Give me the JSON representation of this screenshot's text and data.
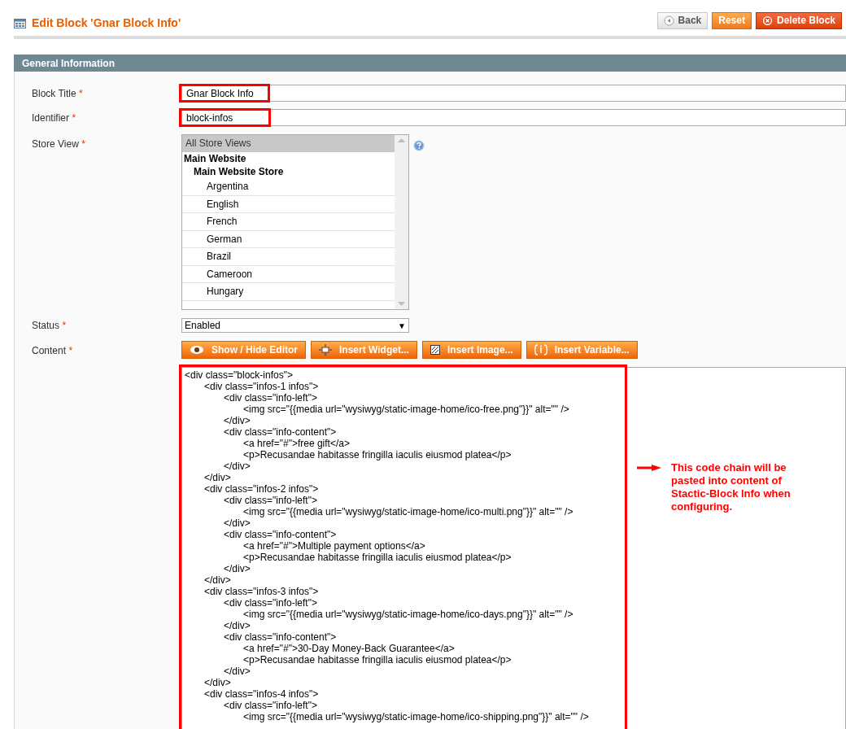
{
  "page": {
    "title": "Edit Block 'Gnar Block Info'",
    "buttons": [
      {
        "kind": "back",
        "label": "Back"
      },
      {
        "kind": "reset",
        "label": "Reset"
      },
      {
        "kind": "delete",
        "label": "Delete Block"
      }
    ]
  },
  "section": {
    "title": "General Information"
  },
  "fields": {
    "block_title": {
      "label": "Block Title",
      "required_mark": "*",
      "value": "Gnar Block Info",
      "highlighted": true
    },
    "identifier": {
      "label": "Identifier",
      "required_mark": "*",
      "value": "block-infos",
      "highlighted": true
    },
    "store_view": {
      "label": "Store View",
      "required_mark": "*",
      "options": [
        {
          "label": "All Store Views",
          "selected": true
        },
        {
          "label": "Main Website",
          "children": [
            {
              "label": "Main Website Store",
              "children": [
                {
                  "label": "Argentina",
                  "selected": false
                },
                {
                  "label": "English",
                  "selected": false
                },
                {
                  "label": "French",
                  "selected": false
                },
                {
                  "label": "German",
                  "selected": false
                },
                {
                  "label": "Brazil",
                  "selected": false
                },
                {
                  "label": "Cameroon",
                  "selected": false
                },
                {
                  "label": "Hungary",
                  "selected": false
                }
              ]
            }
          ]
        }
      ]
    },
    "status": {
      "label": "Status",
      "required_mark": "*",
      "value": "Enabled",
      "caret": "▼"
    },
    "content": {
      "label": "Content",
      "required_mark": "*",
      "highlighted": true,
      "buttons": [
        {
          "kind": "eye",
          "label": "Show / Hide Editor"
        },
        {
          "kind": "widget",
          "label": "Insert Widget..."
        },
        {
          "kind": "image",
          "label": "Insert Image..."
        },
        {
          "kind": "variable",
          "label": "Insert Variable..."
        }
      ],
      "code_lines": [
        "<div class=\"block-infos\">",
        "\t<div class=\"infos-1 infos\">",
        "\t\t<div class=\"info-left\">",
        "\t\t\t<img src=\"{{media url=\"wysiwyg/static-image-home/ico-free.png\"}}\" alt=\"\" />",
        "\t\t</div>",
        "\t\t<div class=\"info-content\">",
        "\t\t\t<a href=\"#\">free gift</a>",
        "\t\t\t<p>Recusandae habitasse fringilla iaculis eiusmod platea</p>",
        "\t\t</div>",
        "\t</div>",
        "\t<div class=\"infos-2 infos\">",
        "\t\t<div class=\"info-left\">",
        "\t\t\t<img src=\"{{media url=\"wysiwyg/static-image-home/ico-multi.png\"}}\" alt=\"\" />",
        "\t\t</div>",
        "\t\t<div class=\"info-content\">",
        "\t\t\t<a href=\"#\">Multiple payment options</a>",
        "\t\t\t<p>Recusandae habitasse fringilla iaculis eiusmod platea</p>",
        "\t\t</div>",
        "\t</div>",
        "\t<div class=\"infos-3 infos\">",
        "\t\t<div class=\"info-left\">",
        "\t\t\t<img src=\"{{media url=\"wysiwyg/static-image-home/ico-days.png\"}}\" alt=\"\" />",
        "\t\t</div>",
        "\t\t<div class=\"info-content\">",
        "\t\t\t<a href=\"#\">30-Day Money-Back Guarantee</a>",
        "\t\t\t<p>Recusandae habitasse fringilla iaculis eiusmod platea</p>",
        "\t\t</div>",
        "\t</div>",
        "\t<div class=\"infos-4 infos\">",
        "\t\t<div class=\"info-left\">",
        "\t\t\t<img src=\"{{media url=\"wysiwyg/static-image-home/ico-shipping.png\"}}\" alt=\"\" />"
      ],
      "annotation": "This code chain will be pasted into content of Stactic-Block Info when configuring."
    }
  }
}
